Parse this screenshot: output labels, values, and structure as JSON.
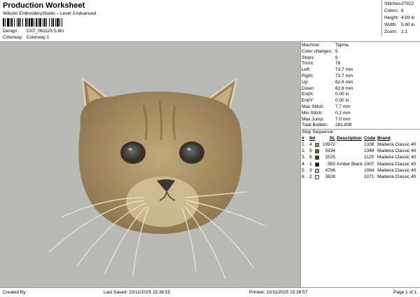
{
  "header": {
    "title": "Production Worksheet",
    "subtitle": "Wilcom EmbroideryStudio – Level 3 Advanced",
    "design_label": "Design:",
    "design_value": "CAT_061125 5,8in",
    "colorway_label": "Colorway:",
    "colorway_value": "Colorway 1"
  },
  "stats": [
    {
      "label": "Stitches:",
      "value": "37922"
    },
    {
      "label": "Colors:",
      "value": "6"
    },
    {
      "label": "Height:",
      "value": "4.93 in"
    },
    {
      "label": "Width:",
      "value": "5.80 in"
    },
    {
      "label": "Zoom:",
      "value": "1:1"
    }
  ],
  "properties": [
    {
      "label": "Machine:",
      "value": "Tajima"
    },
    {
      "label": "Color changes:",
      "value": "5"
    },
    {
      "label": "Stops:",
      "value": "6"
    },
    {
      "label": "Trims:",
      "value": "78"
    },
    {
      "label": "Left:",
      "value": "73.7 mm"
    },
    {
      "label": "Right:",
      "value": "73.7 mm"
    },
    {
      "label": "Up:",
      "value": "62.6 mm"
    },
    {
      "label": "Down:",
      "value": "62.6 mm"
    },
    {
      "label": "EndX:",
      "value": "0.00 in"
    },
    {
      "label": "EndY:",
      "value": "0.00 in"
    },
    {
      "label": "Max Stitch:",
      "value": "7.7 mm"
    },
    {
      "label": "Min Stitch:",
      "value": "0.2 mm"
    },
    {
      "label": "Max Jump:",
      "value": "7.0 mm"
    },
    {
      "label": "Total Bobbin:",
      "value": "261.83ft"
    }
  ],
  "sequence": {
    "title": "Stop Sequence:",
    "headers": {
      "num": "#",
      "n": "N#",
      "st": "St.",
      "desc": "Description",
      "code": "Code",
      "brand": "Brand"
    },
    "rows": [
      {
        "num": "1.",
        "n": "4",
        "color": "#a88a5c",
        "st": "19972",
        "desc": "",
        "code": "1338",
        "brand": "Madeira Classic 40"
      },
      {
        "num": "2.",
        "n": "5",
        "color": "#6e5a3c",
        "st": "5934",
        "desc": "",
        "code": "1348",
        "brand": "Madeira Classic 40"
      },
      {
        "num": "3.",
        "n": "6",
        "color": "#3a3026",
        "st": "2525",
        "desc": "",
        "code": "1129",
        "brand": "Madeira Classic 40"
      },
      {
        "num": "4.",
        "n": "1",
        "color": "#111111",
        "st": "955",
        "desc": "Amber Black",
        "code": "1007",
        "brand": "Madeira Classic 40"
      },
      {
        "num": "5.",
        "n": "3",
        "color": "#cdb48a",
        "st": "4706",
        "desc": "",
        "code": "1084",
        "brand": "Madeira Classic 40"
      },
      {
        "num": "6.",
        "n": "2",
        "color": "#ece4c8",
        "st": "3828",
        "desc": "",
        "code": "1071",
        "brand": "Madeira Classic 40"
      }
    ]
  },
  "footer": {
    "created_by": "Created By:",
    "last_saved": "Last Saved: 10/11/2025 15:38:55",
    "printed": "Printed: 10/11/2025 15:38:57",
    "page": "Page 1 of 1"
  },
  "colors": {
    "canvas_bg": "#b9bab6",
    "fur": "#a0895f",
    "fur_light": "#d8c9a0",
    "whisker": "#f0ead2"
  }
}
